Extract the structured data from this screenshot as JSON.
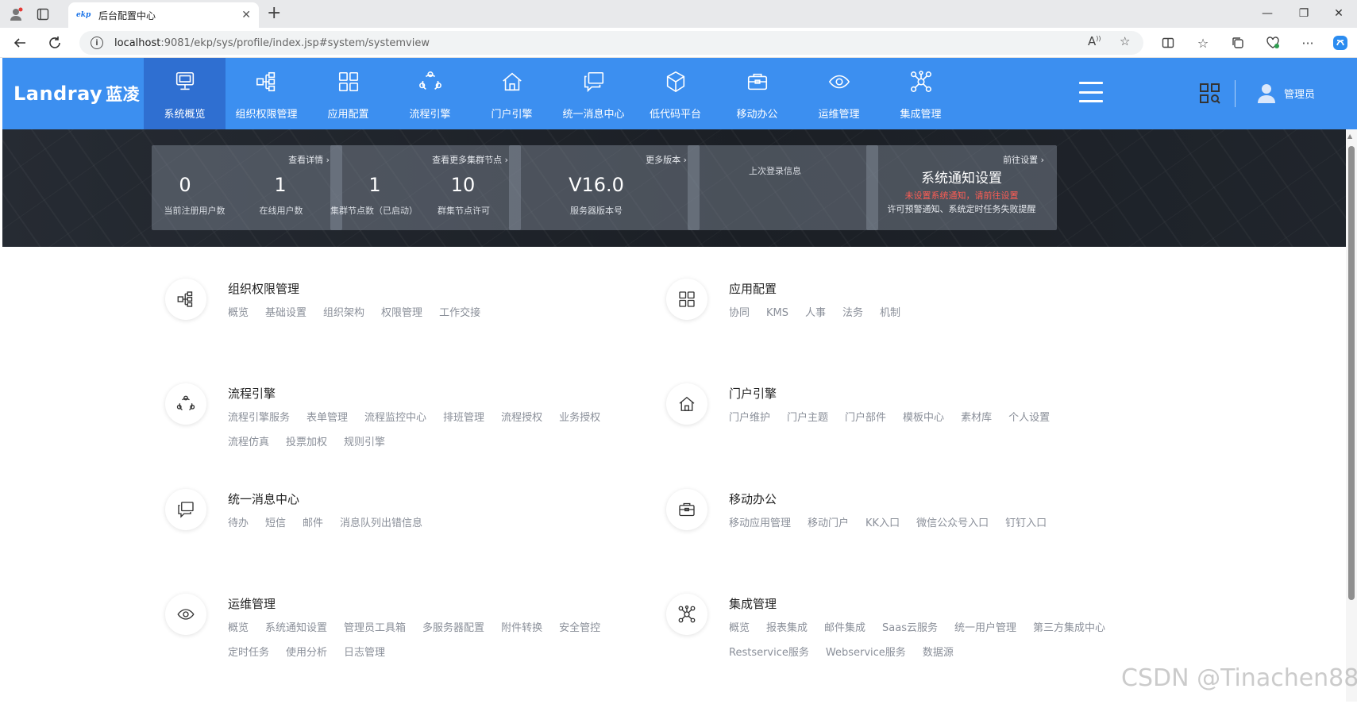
{
  "browser": {
    "tab_title": "后台配置中心",
    "tab_favicon_text": "ekp",
    "url_host": "localhost",
    "url_rest": ":9081/ekp/sys/profile/index.jsp#system/systemview"
  },
  "header": {
    "logo_en": "Landray",
    "logo_cn": "蓝凌",
    "user_label": "管理员",
    "nav": [
      {
        "label": "系统概览",
        "icon": "monitor-icon",
        "active": true
      },
      {
        "label": "组织权限管理",
        "icon": "org-structure-icon"
      },
      {
        "label": "应用配置",
        "icon": "grid-apps-icon"
      },
      {
        "label": "流程引擎",
        "icon": "workflow-cycle-icon"
      },
      {
        "label": "门户引擎",
        "icon": "home-icon"
      },
      {
        "label": "统一消息中心",
        "icon": "message-icon"
      },
      {
        "label": "低代码平台",
        "icon": "cube-icon"
      },
      {
        "label": "移动办公",
        "icon": "briefcase-icon"
      },
      {
        "label": "运维管理",
        "icon": "eye-icon"
      },
      {
        "label": "集成管理",
        "icon": "network-icon"
      }
    ]
  },
  "stats": {
    "users": {
      "link": "查看详情",
      "registered": "0",
      "registered_label": "当前注册用户数",
      "online": "1",
      "online_label": "在线用户数"
    },
    "cluster": {
      "link": "查看更多集群节点",
      "nodes": "1",
      "nodes_label": "集群节点数（已启动）",
      "allowed": "10",
      "allowed_label": "群集节点许可"
    },
    "version": {
      "link": "更多版本",
      "value": "V16.0",
      "label": "服务器版本号"
    },
    "login": {
      "label": "上次登录信息"
    },
    "notify": {
      "link": "前往设置",
      "title": "系统通知设置",
      "warning": "未设置系统通知，请前往设置",
      "desc": "许可预警通知、系统定时任务失败提醒"
    }
  },
  "modules": [
    {
      "title": "组织权限管理",
      "icon": "org-structure-icon",
      "links": [
        "概览",
        "基础设置",
        "组织架构",
        "权限管理",
        "工作交接"
      ]
    },
    {
      "title": "应用配置",
      "icon": "grid-apps-icon",
      "links": [
        "协同",
        "KMS",
        "人事",
        "法务",
        "机制"
      ]
    },
    {
      "title": "流程引擎",
      "icon": "workflow-cycle-icon",
      "links": [
        "流程引擎服务",
        "表单管理",
        "流程监控中心",
        "排班管理",
        "流程授权",
        "业务授权",
        "流程仿真",
        "投票加权",
        "规则引擎"
      ]
    },
    {
      "title": "门户引擎",
      "icon": "home-icon",
      "links": [
        "门户维护",
        "门户主题",
        "门户部件",
        "模板中心",
        "素材库",
        "个人设置"
      ]
    },
    {
      "title": "统一消息中心",
      "icon": "message-icon",
      "links": [
        "待办",
        "短信",
        "邮件",
        "消息队列出错信息"
      ]
    },
    {
      "title": "移动办公",
      "icon": "briefcase-icon",
      "links": [
        "移动应用管理",
        "移动门户",
        "KK入口",
        "微信公众号入口",
        "钉钉入口"
      ]
    },
    {
      "title": "运维管理",
      "icon": "eye-icon",
      "links": [
        "概览",
        "系统通知设置",
        "管理员工具箱",
        "多服务器配置",
        "附件转换",
        "安全管控",
        "定时任务",
        "使用分析",
        "日志管理"
      ]
    },
    {
      "title": "集成管理",
      "icon": "network-icon",
      "links": [
        "概览",
        "报表集成",
        "邮件集成",
        "Saas云服务",
        "统一用户管理",
        "第三方集成中心",
        "Restservice服务",
        "Webservice服务",
        "数据源"
      ]
    }
  ],
  "watermark": "CSDN @Tinachen88",
  "colors": {
    "brand": "#3c8ff0",
    "nav_active": "#2f6fd1",
    "module_icon": "#4a90e2",
    "warning": "#ff5d55"
  }
}
